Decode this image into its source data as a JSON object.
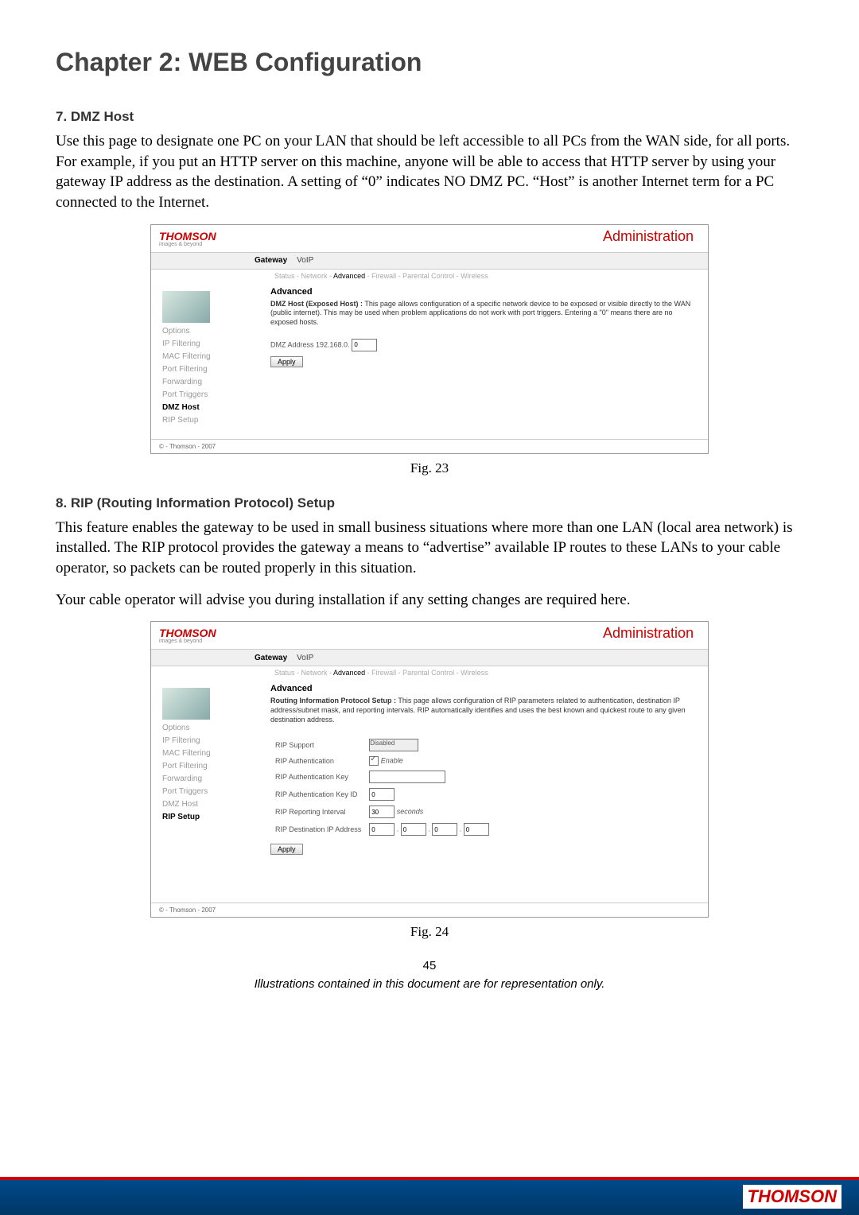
{
  "chapter_title": "Chapter 2: WEB Configuration",
  "sec7": {
    "heading": "7. DMZ Host",
    "body": "Use this page to designate one PC on your LAN that should be left accessible to all PCs from the WAN side, for all ports. For example, if you put an HTTP server on this machine, anyone will be able to access that HTTP server by using your gateway IP address as the destination. A setting of “0” indicates NO DMZ PC. “Host” is another Internet term for a PC connected to the Internet."
  },
  "fig23_caption": "Fig. 23",
  "sec8": {
    "heading": "8. RIP (Routing Information Protocol) Setup",
    "body1": "This feature enables the gateway to be used in small business situations where more than one LAN (local area network) is installed. The RIP protocol provides the gateway a means to “advertise” available IP routes to these LANs to your cable operator, so packets can be routed properly in this situation.",
    "body2": "Your cable operator will advise you during installation if any setting changes are required here."
  },
  "fig24_caption": "Fig. 24",
  "page_number": "45",
  "disclaimer": "Illustrations contained in this document are for representation only.",
  "shot_common": {
    "logo": "THOMSON",
    "logo_sub": "images & beyond",
    "admin": "Administration",
    "tab_gateway": "Gateway",
    "tab_voip": "VoIP",
    "subnav": {
      "status": "Status",
      "network": "Network",
      "advanced": "Advanced",
      "firewall": "Firewall",
      "parental": "Parental Control",
      "wireless": "Wireless"
    },
    "side_items": {
      "options": "Options",
      "ipf": "IP Filtering",
      "macf": "MAC Filtering",
      "portf": "Port Filtering",
      "fwd": "Forwarding",
      "ptrig": "Port Triggers",
      "dmz": "DMZ Host",
      "rip": "RIP Setup"
    },
    "copyright": "© - Thomson - 2007",
    "apply": "Apply"
  },
  "shot1": {
    "section": "Advanced",
    "desc_bold": "DMZ Host (Exposed Host) :",
    "desc": " This page allows configuration of a specific network device to be exposed or visible directly to the WAN (public internet). This may be used when problem applications do not work with port triggers. Entering a \"0\" means there are no exposed hosts.",
    "dmz_label": "DMZ Address 192.168.0.",
    "dmz_value": "0"
  },
  "shot2": {
    "section": "Advanced",
    "desc_bold": "Routing Information Protocol Setup :",
    "desc": " This page allows configuration of RIP parameters related to authentication, destination IP address/subnet mask, and reporting intervals. RIP automatically identifies and uses the best known and quickest route to any given destination address.",
    "fields": {
      "support": "RIP Support",
      "support_val": "Disabled",
      "auth": "RIP Authentication",
      "auth_enable": "Enable",
      "key": "RIP Authentication Key",
      "keyid": "RIP Authentication Key ID",
      "keyid_val": "0",
      "interval": "RIP Reporting Interval",
      "interval_val": "30",
      "interval_unit": "seconds",
      "dest": "RIP Destination IP Address",
      "dest_a": "0",
      "dest_b": "0",
      "dest_c": "0",
      "dest_d": "0"
    }
  },
  "footer_logo": "THOMSON"
}
